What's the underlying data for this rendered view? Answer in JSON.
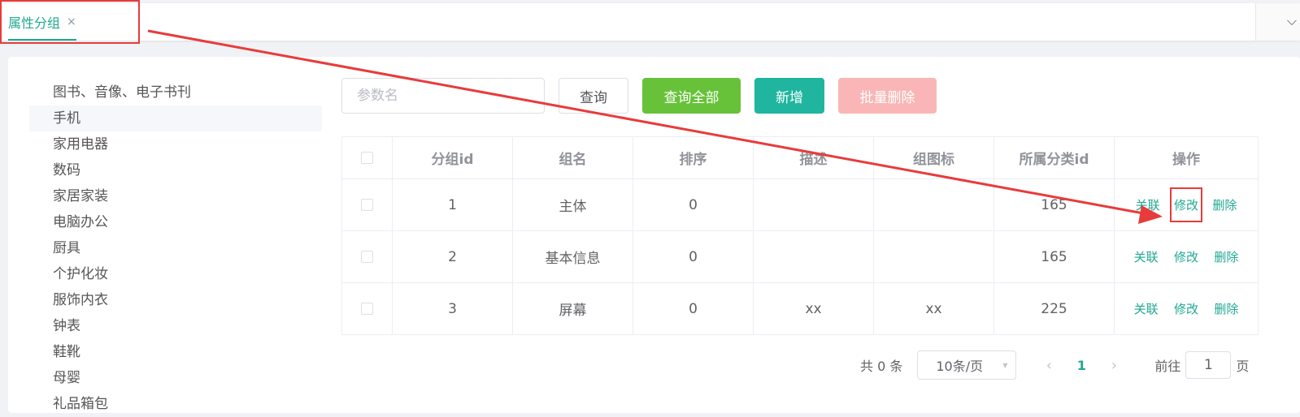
{
  "tab": {
    "label": "属性分组",
    "close": "×"
  },
  "tree": {
    "items": [
      "图书、音像、电子书刊",
      "手机",
      "家用电器",
      "数码",
      "家居家装",
      "电脑办公",
      "厨具",
      "个护化妆",
      "服饰内衣",
      "钟表",
      "鞋靴",
      "母婴",
      "礼品箱包"
    ],
    "selected": "手机"
  },
  "toolbar": {
    "search_placeholder": "参数名",
    "query_label": "查询",
    "query_all_label": "查询全部",
    "add_label": "新增",
    "batch_delete_label": "批量删除"
  },
  "table": {
    "columns": [
      "分组id",
      "组名",
      "排序",
      "描述",
      "组图标",
      "所属分类id",
      "操作"
    ],
    "rows": [
      {
        "id": "1",
        "name": "主体",
        "sort": "0",
        "desc": "",
        "icon": "",
        "catelog_id": "165"
      },
      {
        "id": "2",
        "name": "基本信息",
        "sort": "0",
        "desc": "",
        "icon": "",
        "catelog_id": "165"
      },
      {
        "id": "3",
        "name": "屏幕",
        "sort": "0",
        "desc": "xx",
        "icon": "xx",
        "catelog_id": "225"
      }
    ],
    "actions": {
      "relate": "关联",
      "edit": "修改",
      "delete": "删除"
    }
  },
  "pagination": {
    "total_text": "共 0 条",
    "page_size": "10条/页",
    "current_page": "1",
    "goto_label": "前往",
    "goto_value": "1",
    "unit": "页"
  },
  "colors": {
    "accent": "#20a891",
    "success": "#67c23a",
    "primary": "#20b59f",
    "danger_disabled": "#fab6b6",
    "annotation": "#e83b3b"
  }
}
